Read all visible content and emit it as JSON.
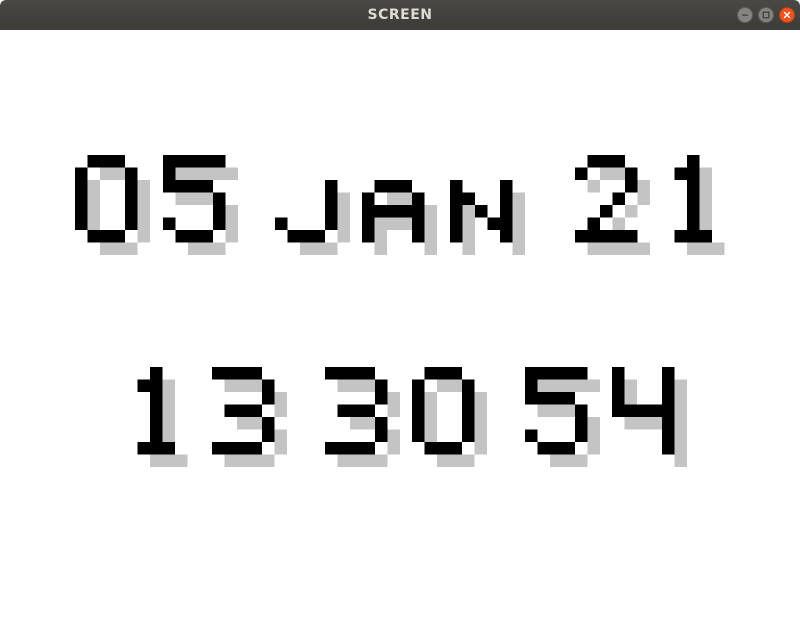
{
  "window": {
    "title": "SCREEN"
  },
  "clock": {
    "date_text": "05 JAN 21",
    "time_text": "13 30 54",
    "date_chars": [
      "0",
      "5",
      "J",
      "A",
      "N",
      "2",
      "1"
    ],
    "time_chars": [
      "1",
      "3",
      "3",
      "0",
      "5",
      "4"
    ]
  },
  "colors": {
    "titlebar": "#3c3b37",
    "title_text": "#dfdbd2",
    "close_button": "#e95420",
    "glyph": "#000000",
    "shadow": "#c4c4c4",
    "background": "#ffffff"
  },
  "icons": {
    "minimize": "minimize-icon",
    "maximize": "maximize-icon",
    "close": "close-icon"
  }
}
